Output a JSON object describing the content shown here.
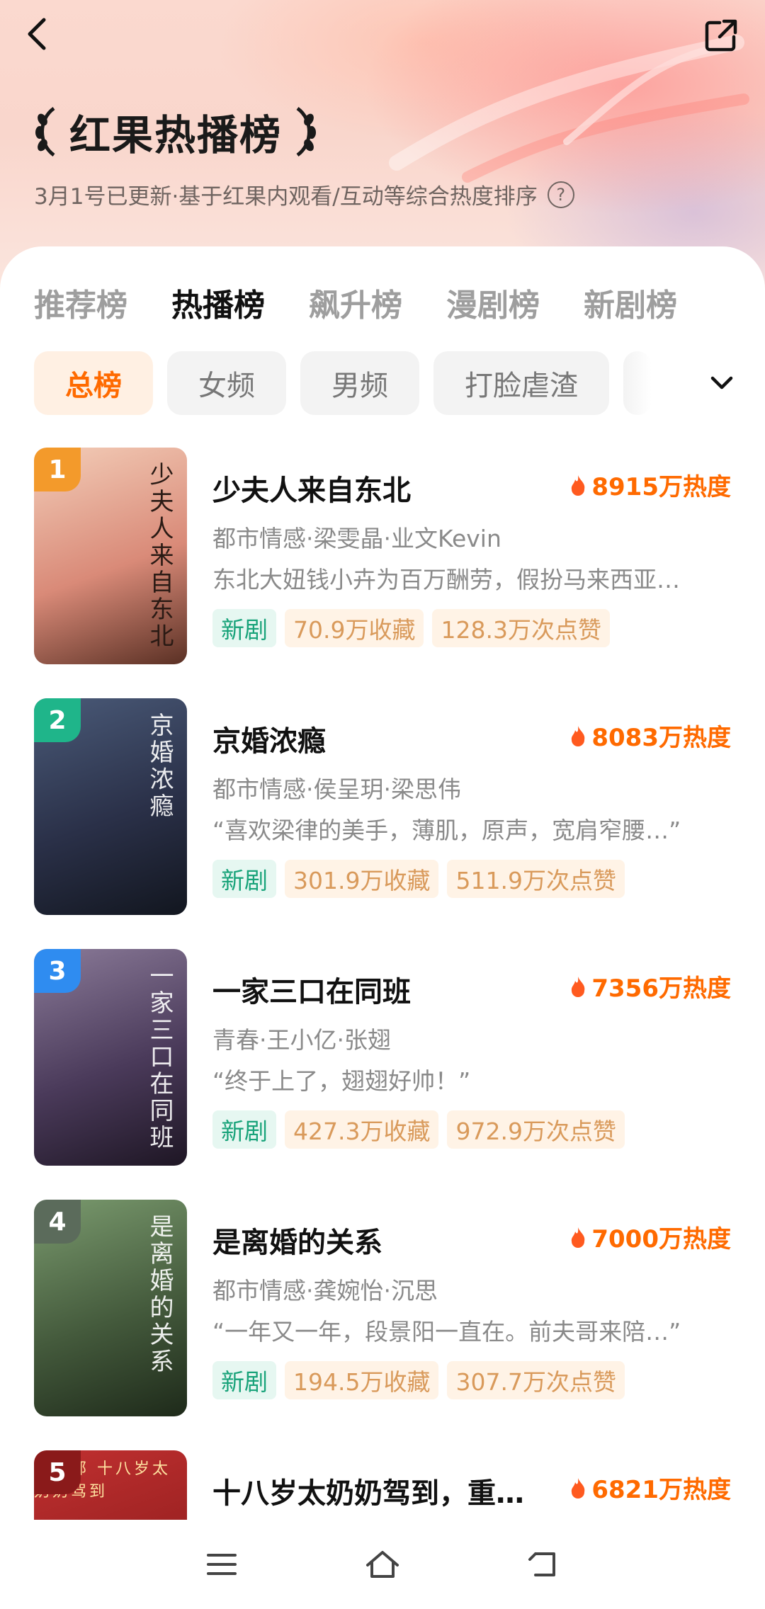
{
  "header": {
    "title": "红果热播榜",
    "subtitle": "3月1号已更新·基于红果内观看/互动等综合热度排序",
    "help_icon": "?"
  },
  "tabs": [
    {
      "label": "推荐榜",
      "active": false
    },
    {
      "label": "热播榜",
      "active": true
    },
    {
      "label": "飙升榜",
      "active": false
    },
    {
      "label": "漫剧榜",
      "active": false
    },
    {
      "label": "新剧榜",
      "active": false
    }
  ],
  "filters": [
    {
      "label": "总榜",
      "active": true
    },
    {
      "label": "女频",
      "active": false
    },
    {
      "label": "男频",
      "active": false
    },
    {
      "label": "打脸虐渣",
      "active": false
    }
  ],
  "items": [
    {
      "rank": "1",
      "title": "少夫人来自东北",
      "heat": "8915万热度",
      "meta": "都市情感·梁雯晶·业文Kevin",
      "desc": "东北大妞钱小卉为百万酬劳，假扮马来西亚…",
      "tag_new": "新剧",
      "favorites": "70.9万收藏",
      "likes": "128.3万次点赞",
      "poster_text": "少夫人来自东北",
      "badge_color": "#f39a2b",
      "poster_colors": [
        "#f0c8b4",
        "#7a4a3a"
      ]
    },
    {
      "rank": "2",
      "title": "京婚浓瘾",
      "heat": "8083万热度",
      "meta": "都市情感·侯呈玥·梁思伟",
      "desc": "“喜欢梁律的美手，薄肌，原声，宽肩窄腰…”",
      "tag_new": "新剧",
      "favorites": "301.9万收藏",
      "likes": "511.9万次点赞",
      "poster_text": "京婚浓瘾",
      "badge_color": "#1fb58a",
      "poster_colors": [
        "#3a4a66",
        "#1a2233"
      ]
    },
    {
      "rank": "3",
      "title": "一家三口在同班",
      "heat": "7356万热度",
      "meta": "青春·王小亿·张翅",
      "desc": "“终于上了，翅翅好帅！”",
      "tag_new": "新剧",
      "favorites": "427.3万收藏",
      "likes": "972.9万次点赞",
      "poster_text": "一家三口在同班",
      "badge_color": "#2f8cf0",
      "poster_colors": [
        "#6a5a7a",
        "#2a2030"
      ]
    },
    {
      "rank": "4",
      "title": "是离婚的关系",
      "heat": "7000万热度",
      "meta": "都市情感·龚婉怡·沉思",
      "desc": "“一年又一年，段景阳一直在。前夫哥来陪…”",
      "tag_new": "新剧",
      "favorites": "194.5万收藏",
      "likes": "307.7万次点赞",
      "poster_text": "是离婚的关系",
      "badge_color": "#5b6b5b",
      "poster_colors": [
        "#5e7a52",
        "#2c3a28"
      ]
    },
    {
      "rank": "5",
      "title": "十八岁太奶奶驾到，重…",
      "heat": "6821万热度",
      "poster_text": "第四部 十八岁太奶奶驾到",
      "badge_color": "#8a1a1a",
      "poster_colors": [
        "#b02a2a",
        "#6a1010"
      ]
    }
  ],
  "icons": {
    "back": "chevron-left-icon",
    "share": "share-icon",
    "dropdown": "chevron-down-icon",
    "heat": "flame-icon",
    "nav": [
      "menu-icon",
      "home-icon",
      "back-nav-icon"
    ]
  },
  "colors": {
    "accent": "#ff6a00",
    "tag_green": "#19a37a",
    "tag_orange": "#d99a5b"
  }
}
